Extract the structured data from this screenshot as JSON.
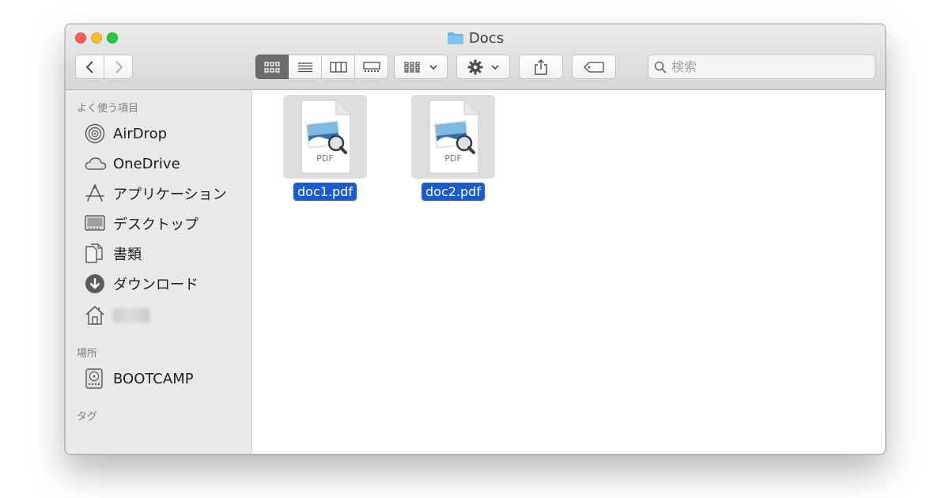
{
  "window": {
    "title": "Docs"
  },
  "toolbar": {
    "back_icon": "chevron-left-icon",
    "forward_icon": "chevron-right-icon",
    "view_modes": [
      "icon-view",
      "list-view",
      "column-view",
      "gallery-view"
    ],
    "active_view": "icon-view",
    "group_icon": "group-by-icon",
    "action_icon": "gear-icon",
    "share_icon": "share-icon",
    "tag_icon": "tag-icon"
  },
  "search": {
    "placeholder": "検索",
    "value": ""
  },
  "sidebar": {
    "favorites_header": "よく使う項目",
    "favorites": [
      {
        "label": "AirDrop",
        "icon": "airdrop-icon"
      },
      {
        "label": "OneDrive",
        "icon": "cloud-icon"
      },
      {
        "label": "アプリケーション",
        "icon": "applications-icon"
      },
      {
        "label": "デスクトップ",
        "icon": "desktop-icon"
      },
      {
        "label": "書類",
        "icon": "documents-icon"
      },
      {
        "label": "ダウンロード",
        "icon": "download-icon"
      },
      {
        "label": "",
        "icon": "home-icon"
      }
    ],
    "locations_header": "場所",
    "locations": [
      {
        "label": "BOOTCAMP",
        "icon": "disk-icon"
      }
    ],
    "tags_header": "タグ"
  },
  "files": [
    {
      "name": "doc1.pdf",
      "badge": "PDF",
      "selected": true
    },
    {
      "name": "doc2.pdf",
      "badge": "PDF",
      "selected": true
    }
  ],
  "colors": {
    "selection": "#1b5ad1",
    "close": "#fc5f57",
    "minimize": "#fdbc2e",
    "zoom": "#28c840"
  }
}
